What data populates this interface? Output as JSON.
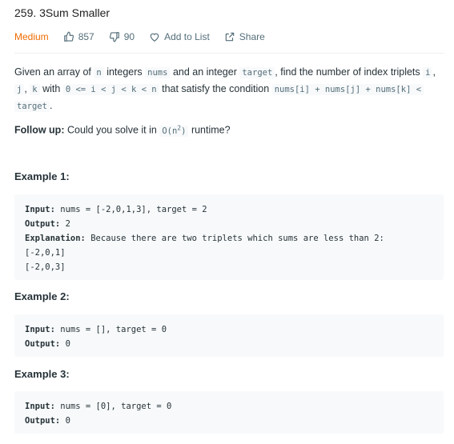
{
  "problem": {
    "title": "259. 3Sum Smaller",
    "difficulty": "Medium",
    "likes": "857",
    "dislikes": "90",
    "add_to_list": "Add to List",
    "share": "Share"
  },
  "description": {
    "t1": "Given an array of",
    "c1": "n",
    "t2": "integers",
    "c2": "nums",
    "t3": "and an integer",
    "c3": "target",
    "t4": ", find the number of index triplets",
    "c4": "i",
    "t5": ",",
    "c5": "j",
    "t6": ",",
    "c6": "k",
    "t7": "with",
    "c7": "0 <= i < j < k < n",
    "t8": "that satisfy the condition",
    "c8": "nums[i] + nums[j] + nums[k] <",
    "c9": "target",
    "t9": "."
  },
  "follow_up": {
    "label": "Follow up:",
    "text": "Could you solve it in",
    "code": "O(n",
    "sup": "2",
    "code_end": ")",
    "end": "runtime?"
  },
  "examples": [
    {
      "title": "Example 1:",
      "lines": [
        {
          "label": "Input:",
          "text": "nums = [-2,0,1,3], target = 2"
        },
        {
          "label": "Output:",
          "text": "2"
        },
        {
          "label": "Explanation:",
          "text": "Because there are two triplets which sums are less than 2:"
        },
        {
          "label": "",
          "text": "[-2,0,1]"
        },
        {
          "label": "",
          "text": "[-2,0,3]"
        }
      ]
    },
    {
      "title": "Example 2:",
      "lines": [
        {
          "label": "Input:",
          "text": "nums = [], target = 0"
        },
        {
          "label": "Output:",
          "text": "0"
        }
      ]
    },
    {
      "title": "Example 3:",
      "lines": [
        {
          "label": "Input:",
          "text": "nums = [0], target = 0"
        },
        {
          "label": "Output:",
          "text": "0"
        }
      ]
    }
  ]
}
